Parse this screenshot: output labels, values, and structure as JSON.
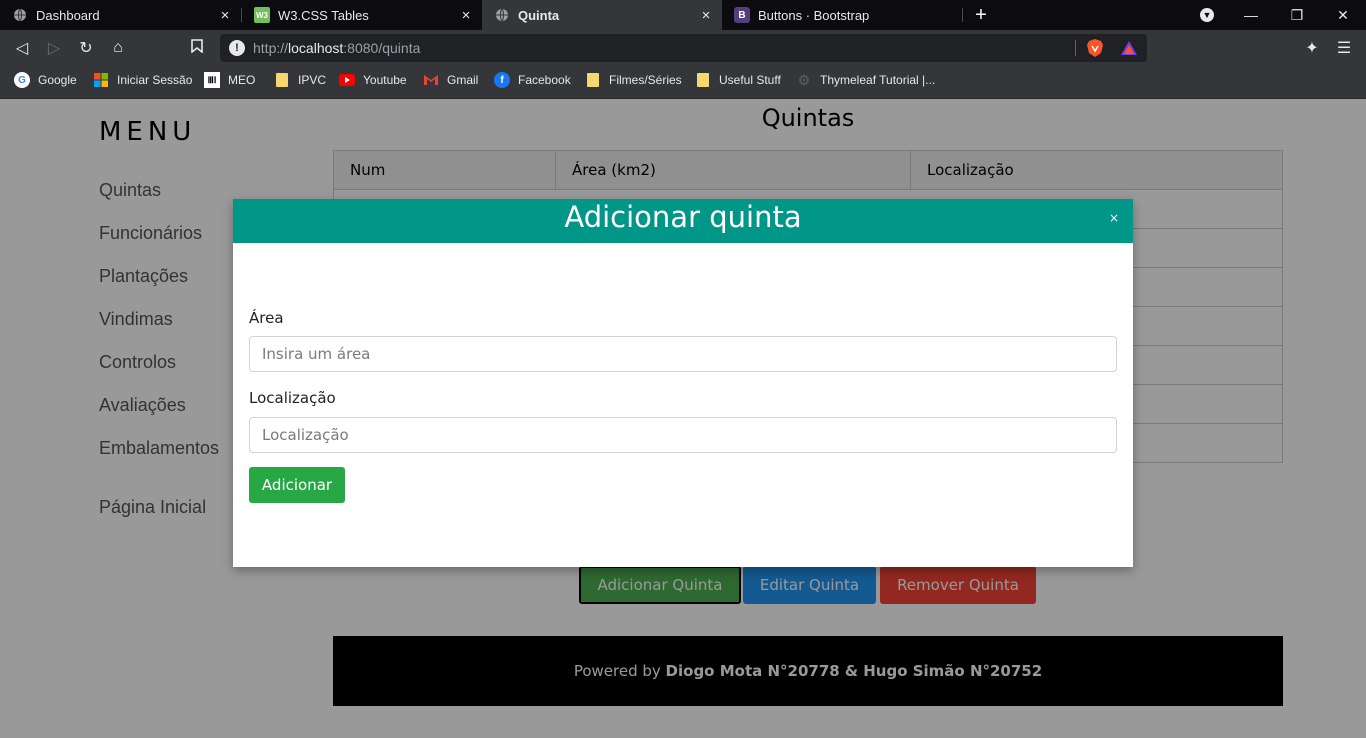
{
  "browser": {
    "tabs": [
      {
        "title": "Dashboard",
        "favicon": "globe-icon"
      },
      {
        "title": "W3.CSS Tables",
        "favicon": "w3-icon"
      },
      {
        "title": "Quinta",
        "favicon": "globe-icon",
        "active": true
      },
      {
        "title": "Buttons · Bootstrap",
        "favicon": "bootstrap-icon"
      }
    ],
    "url_prefix": "http://",
    "url_host": "localhost",
    "url_path": ":8080/quinta",
    "bookmarks": [
      "Google",
      "Iniciar Sessão",
      "MEO",
      "IPVC",
      "Youtube",
      "Gmail",
      "Facebook",
      "Filmes/Séries",
      "Useful Stuff",
      "Thymeleaf Tutorial |..."
    ]
  },
  "sidebar": {
    "title": "MENU",
    "items": [
      "Quintas",
      "Funcionários",
      "Plantações",
      "Vindimas",
      "Controlos",
      "Avaliações",
      "Embalamentos"
    ],
    "home": "Página Inicial"
  },
  "main": {
    "title": "Quintas",
    "table": {
      "headers": [
        "Num",
        "Área (km2)",
        "Localização"
      ],
      "row_count": 7
    },
    "buttons": {
      "add": "Adicionar Quinta",
      "edit": "Editar Quinta",
      "remove": "Remover Quinta"
    },
    "footer": {
      "prefix": "Powered by",
      "authors": "Diogo Mota N°20778 & Hugo Simão N°20752"
    }
  },
  "modal": {
    "title": "Adicionar quinta",
    "close": "×",
    "area_label": "Área",
    "area_placeholder": "Insira um área",
    "location_label": "Localização",
    "location_placeholder": "Localização",
    "submit": "Adicionar"
  },
  "colors": {
    "modal_header": "#009688",
    "success": "#28a745",
    "primary": "#2196F3",
    "danger": "#f44336"
  }
}
